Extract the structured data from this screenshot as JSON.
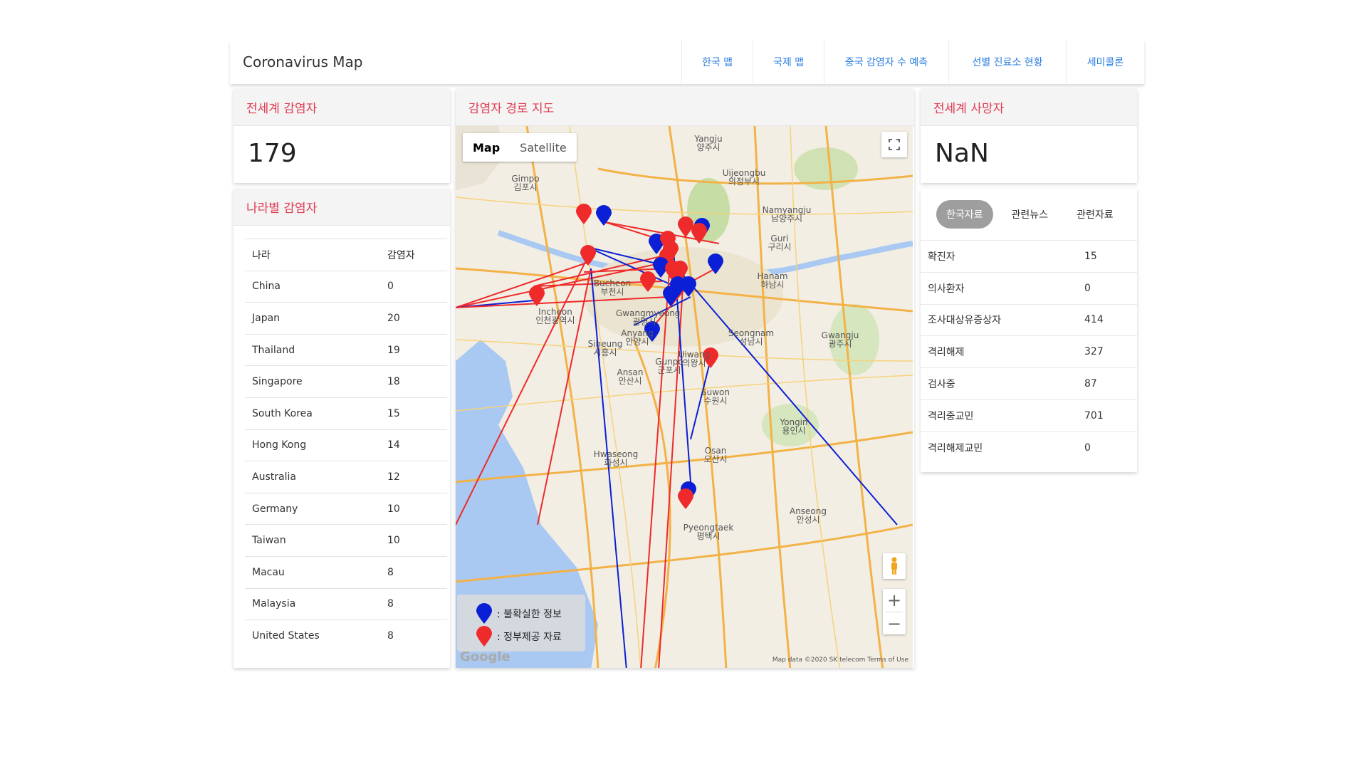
{
  "app": {
    "title": "Coronavirus Map"
  },
  "nav": [
    {
      "label": "한국 맵"
    },
    {
      "label": "국제 맵"
    },
    {
      "label": "중국 감염자 수 예측"
    },
    {
      "label": "선별 진료소 현황"
    },
    {
      "label": "세미콜론"
    }
  ],
  "world_confirmed": {
    "title": "전세계 감염자",
    "value": "179"
  },
  "country_cases": {
    "title": "나라별 감염자",
    "columns": [
      "나라",
      "감염자"
    ],
    "rows": [
      [
        "China",
        "0"
      ],
      [
        "Japan",
        "20"
      ],
      [
        "Thailand",
        "19"
      ],
      [
        "Singapore",
        "18"
      ],
      [
        "South Korea",
        "15"
      ],
      [
        "Hong Kong",
        "14"
      ],
      [
        "Australia",
        "12"
      ],
      [
        "Germany",
        "10"
      ],
      [
        "Taiwan",
        "10"
      ],
      [
        "Macau",
        "8"
      ],
      [
        "Malaysia",
        "8"
      ],
      [
        "United States",
        "8"
      ]
    ]
  },
  "route_map": {
    "title": "감염자 경로 지도",
    "map_type_buttons": {
      "map": "Map",
      "satellite": "Satellite"
    },
    "legend": {
      "unverified": ": 불확실한 정보",
      "government": ": 정부제공 자료"
    },
    "legend_colors": {
      "unverified": "#0a1fd6",
      "government": "#ef2a2a"
    },
    "logo": "Google",
    "attribution": "Map data ©2020 SK telecom    Terms of Use",
    "zoom_in": "+",
    "zoom_out": "−",
    "cities": [
      {
        "en": "Yangju",
        "ko": "양주시"
      },
      {
        "en": "Uijeongbu",
        "ko": "의정부시"
      },
      {
        "en": "Gimpo",
        "ko": "김포시"
      },
      {
        "en": "Namyangju",
        "ko": "남양주시"
      },
      {
        "en": "Guri",
        "ko": "구리시"
      },
      {
        "en": "Hanam",
        "ko": "하남시"
      },
      {
        "en": "Bucheon",
        "ko": "부천시"
      },
      {
        "en": "Incheon",
        "ko": "인천광역시"
      },
      {
        "en": "Gwangmyeong",
        "ko": "광명시"
      },
      {
        "en": "Siheung",
        "ko": "시흥시"
      },
      {
        "en": "Anyang",
        "ko": "안양시"
      },
      {
        "en": "Seongnam",
        "ko": "성남시"
      },
      {
        "en": "Gwangju",
        "ko": "광주시"
      },
      {
        "en": "Uiwang",
        "ko": "의왕시"
      },
      {
        "en": "Gunpo",
        "ko": "군포시"
      },
      {
        "en": "Ansan",
        "ko": "안산시"
      },
      {
        "en": "Suwon",
        "ko": "수원시"
      },
      {
        "en": "Yongin",
        "ko": "용인시"
      },
      {
        "en": "Hwaseong",
        "ko": "화성시"
      },
      {
        "en": "Osan",
        "ko": "오산시"
      },
      {
        "en": "Anseong",
        "ko": "안성시"
      },
      {
        "en": "Pyeongtaek",
        "ko": "평택시"
      }
    ]
  },
  "world_deaths": {
    "title": "전세계 사망자",
    "value": "NaN"
  },
  "info_tabs": [
    {
      "label": "한국자료",
      "active": true
    },
    {
      "label": "관련뉴스",
      "active": false
    },
    {
      "label": "관련자료",
      "active": false
    }
  ],
  "korea_stats": [
    [
      "확진자",
      "15"
    ],
    [
      "의사환자",
      "0"
    ],
    [
      "조사대상유증상자",
      "414"
    ],
    [
      "격리해제",
      "327"
    ],
    [
      "검사중",
      "87"
    ],
    [
      "격리중교민",
      "701"
    ],
    [
      "격리해제교민",
      "0"
    ]
  ]
}
